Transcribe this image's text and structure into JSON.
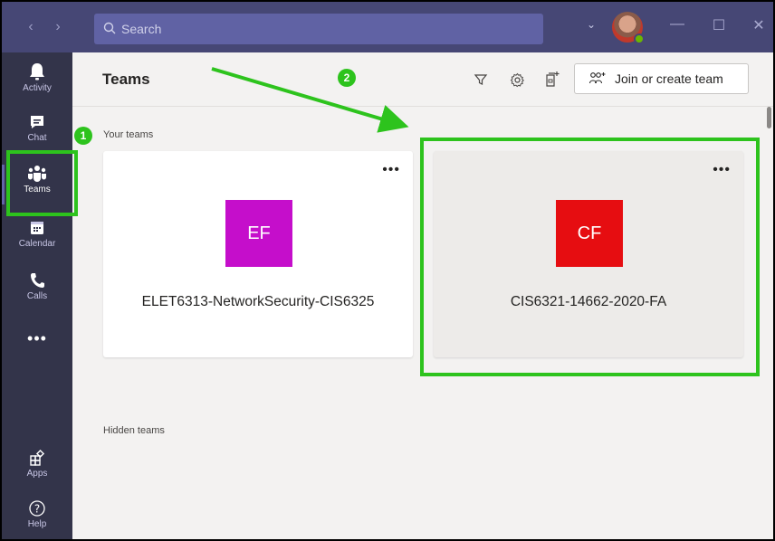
{
  "titlebar": {
    "back_icon": "chevron-left-icon",
    "forward_icon": "chevron-right-icon",
    "search_placeholder": "Search",
    "minimize_glyph": "—",
    "maximize_glyph": "☐",
    "close_glyph": "✕"
  },
  "rail": {
    "items": [
      {
        "label": "Activity",
        "icon": "bell-icon"
      },
      {
        "label": "Chat",
        "icon": "chat-icon"
      },
      {
        "label": "Teams",
        "icon": "teams-icon",
        "active": true
      },
      {
        "label": "Calendar",
        "icon": "calendar-icon"
      },
      {
        "label": "Calls",
        "icon": "phone-icon"
      }
    ],
    "more_glyph": "•••",
    "apps_label": "Apps",
    "help_label": "Help",
    "help_glyph": "?"
  },
  "main": {
    "title": "Teams",
    "join_button_label": "Join or create team",
    "your_teams_label": "Your teams",
    "hidden_teams_label": "Hidden teams",
    "teams": [
      {
        "initials": "EF",
        "name": "ELET6313-NetworkSecurity-CIS6325",
        "color": "#c50ecb",
        "menu": "•••"
      },
      {
        "initials": "CF",
        "name": "CIS6321-14662-2020-FA",
        "color": "#e60d11",
        "menu": "•••"
      }
    ]
  },
  "annotations": {
    "badge_1": "1",
    "badge_2": "2",
    "highlight_color": "#2dc31d"
  },
  "colors": {
    "titlebar": "#464775",
    "rail": "#33344a",
    "accent": "#6264a7",
    "main_bg": "#f3f2f1"
  }
}
